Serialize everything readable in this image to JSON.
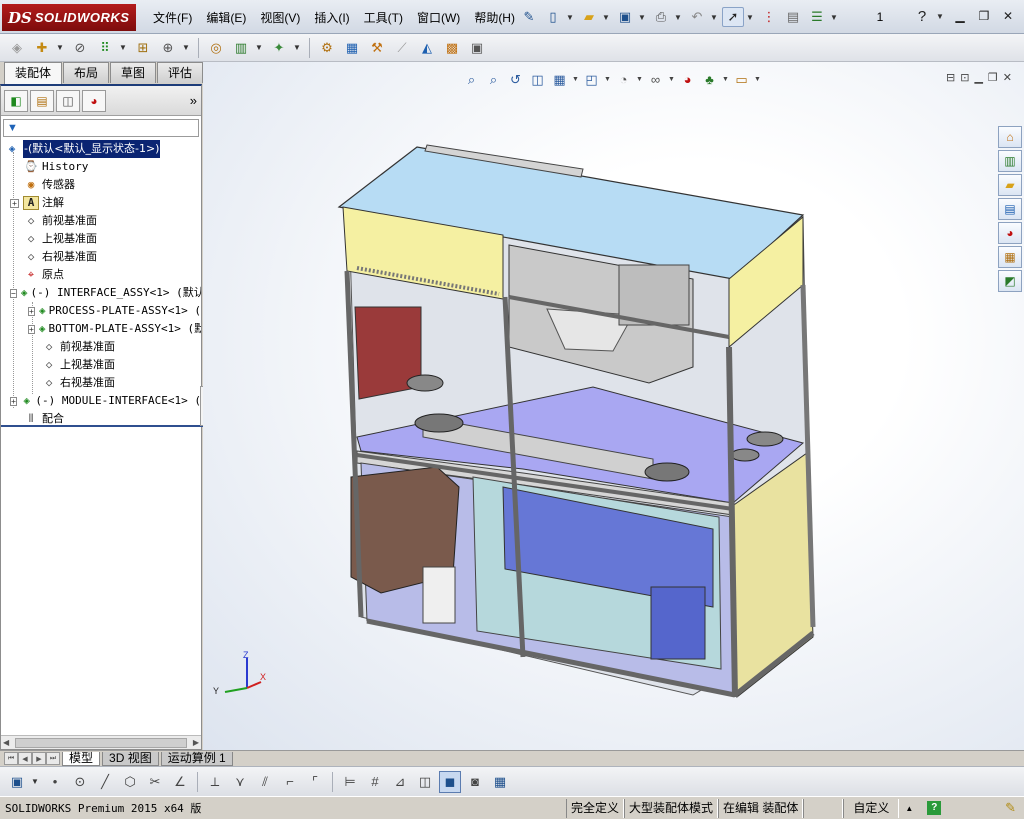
{
  "app": {
    "logo_ds": "DS",
    "logo_name": "SOLIDWORKS",
    "page_number": "1",
    "accent_red": "#a01515"
  },
  "menu": [
    "文件(F)",
    "编辑(E)",
    "视图(V)",
    "插入(I)",
    "工具(T)",
    "窗口(W)",
    "帮助(H)"
  ],
  "command_tabs": [
    {
      "label": "装配体",
      "active": true
    },
    {
      "label": "布局",
      "active": false
    },
    {
      "label": "草图",
      "active": false
    },
    {
      "label": "评估",
      "active": false
    }
  ],
  "tree": {
    "root": "-(默认<默认_显示状态-1>)",
    "items": [
      {
        "label": "History",
        "icon": "history-icon",
        "expandable": false,
        "level": 1
      },
      {
        "label": "传感器",
        "icon": "sensor-icon",
        "expandable": false,
        "level": 1
      },
      {
        "label": "注解",
        "icon": "annotation-icon",
        "expandable": true,
        "level": 1
      },
      {
        "label": "前视基准面",
        "icon": "plane-icon",
        "expandable": false,
        "level": 1
      },
      {
        "label": "上视基准面",
        "icon": "plane-icon",
        "expandable": false,
        "level": 1
      },
      {
        "label": "右视基准面",
        "icon": "plane-icon",
        "expandable": false,
        "level": 1
      },
      {
        "label": "原点",
        "icon": "origin-icon",
        "expandable": false,
        "level": 1
      },
      {
        "label": "(-) INTERFACE_ASSY<1> (默认",
        "icon": "subassembly-icon",
        "expandable": true,
        "level": 1,
        "expanded": true
      },
      {
        "label": "PROCESS-PLATE-ASSY<1> (",
        "icon": "subassembly-icon",
        "expandable": true,
        "level": 2
      },
      {
        "label": "BOTTOM-PLATE-ASSY<1> (默",
        "icon": "subassembly-icon",
        "expandable": true,
        "level": 2
      },
      {
        "label": "前视基准面",
        "icon": "plane-icon",
        "expandable": false,
        "level": 2
      },
      {
        "label": "上视基准面",
        "icon": "plane-icon",
        "expandable": false,
        "level": 2
      },
      {
        "label": "右视基准面",
        "icon": "plane-icon",
        "expandable": false,
        "level": 2
      },
      {
        "label": "(-) MODULE-INTERFACE<1> (",
        "icon": "subassembly-icon",
        "expandable": true,
        "level": 1
      },
      {
        "label": "配合",
        "icon": "mates-icon",
        "expandable": false,
        "level": 1
      }
    ]
  },
  "sheet_tabs": [
    {
      "label": "模型",
      "active": true
    },
    {
      "label": "3D 视图",
      "active": false
    },
    {
      "label": "运动算例 1",
      "active": false
    }
  ],
  "triad": {
    "x": "X",
    "y": "Y",
    "z": "Z"
  },
  "status": {
    "product": "SOLIDWORKS Premium 2015 x64 版",
    "definition": "完全定义",
    "mode": "大型装配体模式",
    "editing": "在编辑 装配体",
    "units": "自定义",
    "help": "?"
  }
}
